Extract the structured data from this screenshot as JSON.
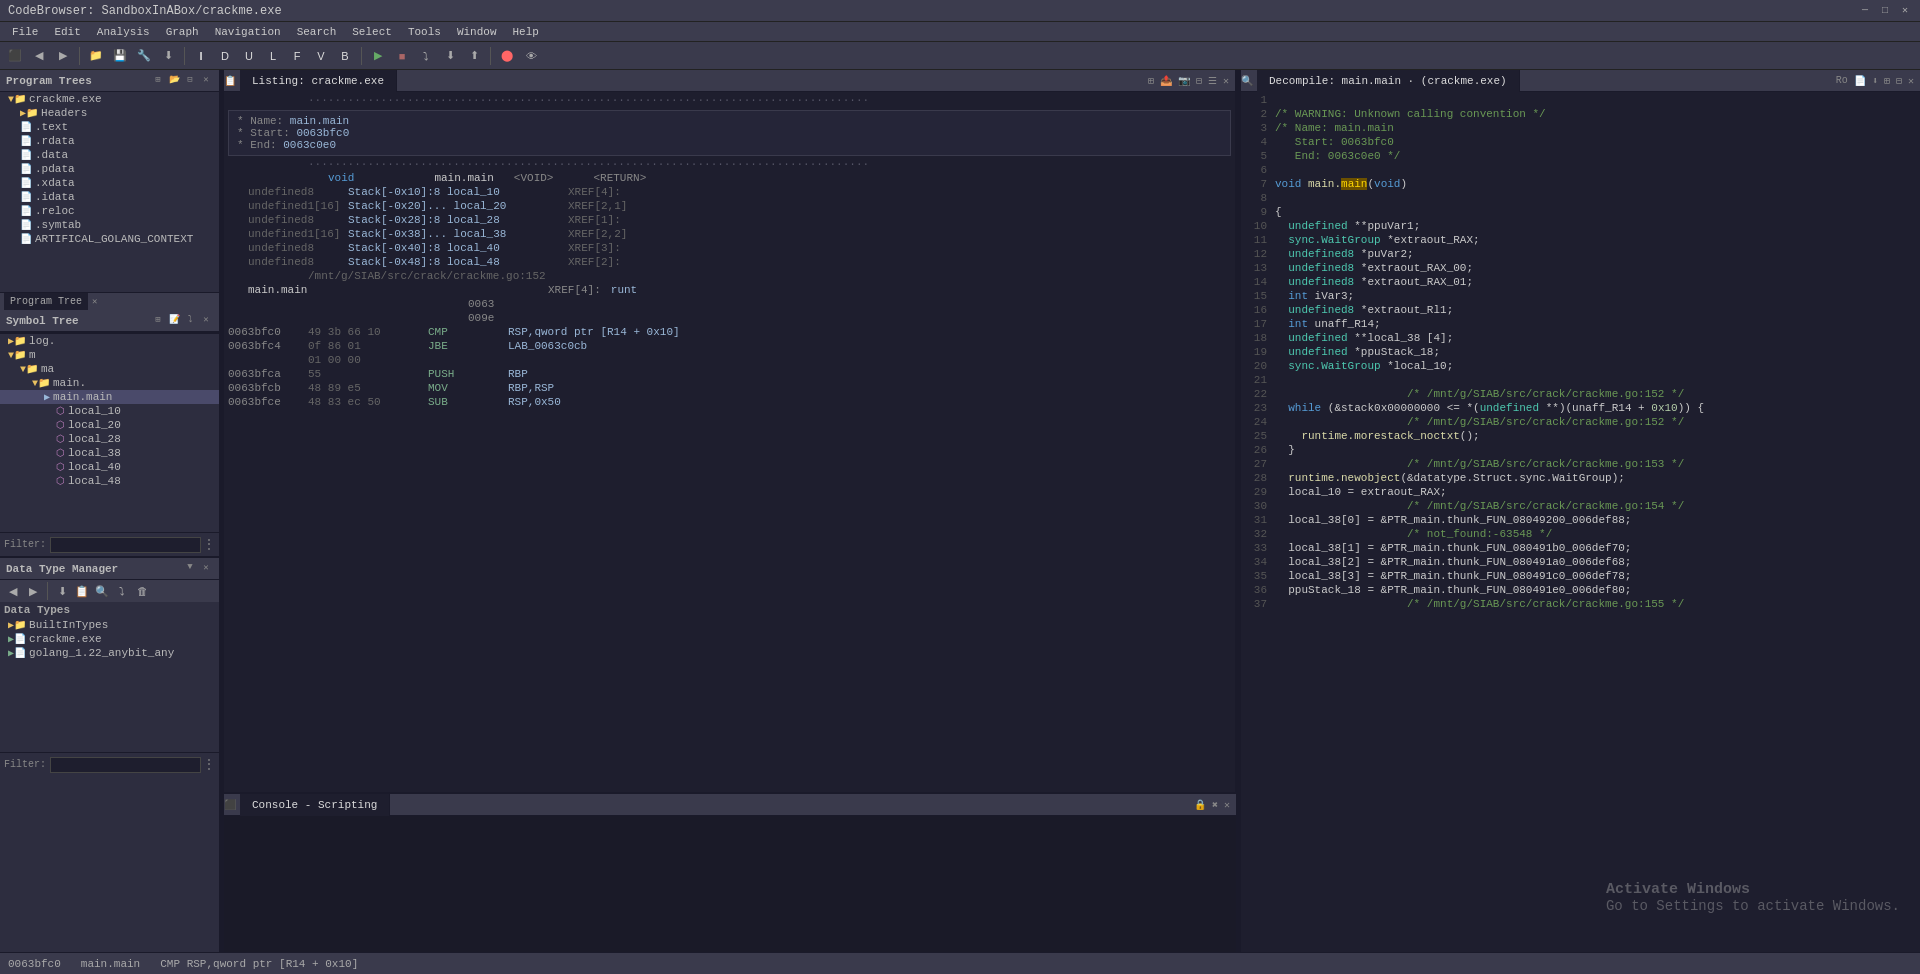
{
  "titlebar": {
    "title": "CodeBrowser: SandboxInABox/crackme.exe",
    "controls": [
      "_",
      "□",
      "×"
    ]
  },
  "menubar": {
    "items": [
      "File",
      "Edit",
      "Analysis",
      "Graph",
      "Navigation",
      "Search",
      "Select",
      "Tools",
      "Window",
      "Help"
    ]
  },
  "left_panel": {
    "program_trees": {
      "title": "Program Trees",
      "items": [
        {
          "label": "crackme.exe",
          "type": "folder",
          "indent": 0
        },
        {
          "label": "Headers",
          "type": "folder",
          "indent": 1
        },
        {
          "label": ".text",
          "type": "section",
          "indent": 1
        },
        {
          "label": ".rdata",
          "type": "section",
          "indent": 1
        },
        {
          "label": ".data",
          "type": "section",
          "indent": 1
        },
        {
          "label": ".pdata",
          "type": "section",
          "indent": 1
        },
        {
          "label": ".xdata",
          "type": "section",
          "indent": 1
        },
        {
          "label": ".idata",
          "type": "section",
          "indent": 1
        },
        {
          "label": ".reloc",
          "type": "section",
          "indent": 1
        },
        {
          "label": ".symtab",
          "type": "section",
          "indent": 1
        },
        {
          "label": "ARTIFICAL_GOLANG_CONTEXT",
          "type": "section",
          "indent": 1
        }
      ]
    },
    "symbol_tree": {
      "title": "Symbol Tree",
      "items": [
        {
          "label": "log.",
          "type": "folder",
          "indent": 0,
          "expanded": false
        },
        {
          "label": "m",
          "type": "folder",
          "indent": 0,
          "expanded": true
        },
        {
          "label": "ma",
          "type": "folder",
          "indent": 1,
          "expanded": true
        },
        {
          "label": "main.",
          "type": "folder",
          "indent": 2,
          "expanded": true
        },
        {
          "label": "main.main",
          "type": "func",
          "indent": 3,
          "selected": true
        },
        {
          "label": "local_10",
          "type": "var",
          "indent": 4
        },
        {
          "label": "local_20",
          "type": "var",
          "indent": 4
        },
        {
          "label": "local_28",
          "type": "var",
          "indent": 4
        },
        {
          "label": "local_38",
          "type": "var",
          "indent": 4
        },
        {
          "label": "local_40",
          "type": "var",
          "indent": 4
        },
        {
          "label": "local_48",
          "type": "var",
          "indent": 4
        }
      ]
    },
    "filter": ""
  },
  "data_type_manager": {
    "title": "Data Type Manager",
    "items": [
      {
        "label": "BuiltInTypes",
        "type": "folder",
        "indent": 0
      },
      {
        "label": "crackme.exe",
        "type": "file",
        "indent": 0
      },
      {
        "label": "golang_1.22_anybit_any",
        "type": "file",
        "indent": 0
      }
    ],
    "filter": ""
  },
  "listing": {
    "title": "Listing: crackme.exe",
    "addr_start": "0063bfc0",
    "info_block": {
      "name": "main.main",
      "start": "0063bfc0",
      "end": "0063c0e0"
    },
    "prototype": "void main.main(void)",
    "params": [
      {
        "type": "<VOID>",
        "name": "<RETURN>"
      }
    ],
    "locals": [
      {
        "type": "undefined8",
        "loc": "Stack[-0x10]:8",
        "name": "local_10",
        "xref": "XREF[4]:"
      },
      {
        "type": "undefined1[16]",
        "loc": "Stack[-0x20]...",
        "name": "local_20",
        "xref": "XREF[2,1]"
      },
      {
        "type": "undefined8",
        "loc": "Stack[-0x28]:8",
        "name": "local_28",
        "xref": "XREF[1]:"
      },
      {
        "type": "undefined1[16]",
        "loc": "Stack[-0x38]...",
        "name": "local_38",
        "xref": "XREF[2,2]"
      },
      {
        "type": "undefined8",
        "loc": "Stack[-0x40]:8",
        "name": "local_40",
        "xref": "XREF[3]:"
      },
      {
        "type": "undefined8",
        "loc": "Stack[-0x48]:8",
        "name": "local_48",
        "xref": "XREF[2]:"
      }
    ],
    "source_comment": "/mnt/g/SIAB/src/crack/crackme.go:152",
    "main_main_label": "main.main",
    "instructions": [
      {
        "addr": "0063bfc0",
        "bytes": "49 3b 66 10",
        "mnem": "CMP",
        "operand": "RSP,qword ptr [R14 + 0x10]"
      },
      {
        "addr": "0063bfc4",
        "bytes": "0f 86 01",
        "mnem": "JBE",
        "operand": "LAB_0063c0cb"
      },
      {
        "addr": "",
        "bytes": "01 00 00",
        "mnem": "",
        "operand": ""
      },
      {
        "addr": "0063bfca",
        "bytes": "55",
        "mnem": "PUSH",
        "operand": "RBP"
      },
      {
        "addr": "0063bfcb",
        "bytes": "48 89 e5",
        "mnem": "MOV",
        "operand": "RBP,RSP"
      },
      {
        "addr": "0063bfce",
        "bytes": "48 83 ec 50",
        "mnem": "SUB",
        "operand": "RSP,0x50"
      }
    ]
  },
  "decompiler": {
    "title": "Decompile: main.main · (crackme.exe)",
    "lines": [
      {
        "num": "1",
        "text": ""
      },
      {
        "num": "2",
        "text": "/* WARNING: Unknown calling convention */",
        "class": "c-comment"
      },
      {
        "num": "3",
        "text": "/* Name: main.main",
        "class": "c-comment"
      },
      {
        "num": "4",
        "text": "   Start: 0063bfc0",
        "class": "c-comment"
      },
      {
        "num": "5",
        "text": "   End: 0063c0e0 */",
        "class": "c-comment"
      },
      {
        "num": "6",
        "text": ""
      },
      {
        "num": "7",
        "text": "void main.main(void)"
      },
      {
        "num": "8",
        "text": ""
      },
      {
        "num": "9",
        "text": "{"
      },
      {
        "num": "10",
        "text": "  undefined **ppuVar1;"
      },
      {
        "num": "11",
        "text": "  sync.WaitGroup *extraout_RAX;"
      },
      {
        "num": "12",
        "text": "  undefined8 *puVar2;"
      },
      {
        "num": "13",
        "text": "  undefined8 *extraout_RAX_00;"
      },
      {
        "num": "14",
        "text": "  undefined8 *extraout_RAX_01;"
      },
      {
        "num": "15",
        "text": "  int iVar3;"
      },
      {
        "num": "16",
        "text": "  undefined8 *extraout_Rl1;"
      },
      {
        "num": "17",
        "text": "  int unaff_R14;"
      },
      {
        "num": "18",
        "text": "  undefined **local_38 [4];"
      },
      {
        "num": "19",
        "text": "  undefined *ppuStack_18;"
      },
      {
        "num": "20",
        "text": "  sync.WaitGroup *local_10;"
      },
      {
        "num": "21",
        "text": ""
      },
      {
        "num": "22",
        "text": "                    /* /mnt/g/SIAB/src/crack/crackme.go:152 */",
        "class": "c-comment"
      },
      {
        "num": "23",
        "text": "  while (&stack0x00000000 <= *(undefined **)(unaff_R14 + 0x10)) {"
      },
      {
        "num": "24",
        "text": "                    /* /mnt/g/SIAB/src/crack/crackme.go:152 */",
        "class": "c-comment"
      },
      {
        "num": "25",
        "text": "    runtime.morestack_noctxt();"
      },
      {
        "num": "26",
        "text": "  }"
      },
      {
        "num": "27",
        "text": "                    /* /mnt/g/SIAB/src/crack/crackme.go:153 */",
        "class": "c-comment"
      },
      {
        "num": "28",
        "text": "  runtime.newobject(&datatype.Struct.sync.WaitGroup);"
      },
      {
        "num": "29",
        "text": "  local_10 = extraout_RAX;"
      },
      {
        "num": "30",
        "text": "                    /* /mnt/g/SIAB/src/crack/crackme.go:154 */",
        "class": "c-comment"
      },
      {
        "num": "31",
        "text": "  local_38[0] = &PTR_main.thunk_FUN_08049200_006def88;"
      },
      {
        "num": "32",
        "text": "                    /* not_found:-63548 */",
        "class": "c-comment"
      },
      {
        "num": "33",
        "text": "  local_38[1] = &PTR_main.thunk_FUN_080491b0_006def70;"
      },
      {
        "num": "34",
        "text": "  local_38[2] = &PTR_main.thunk_FUN_080491a0_006def68;"
      },
      {
        "num": "35",
        "text": "  local_38[3] = &PTR_main.thunk_FUN_080491c0_006def78;"
      },
      {
        "num": "36",
        "text": "  ppuStack_18 = &PTR_main.thunk_FUN_080491e0_006def80;"
      },
      {
        "num": "37",
        "text": "                    /* /mnt/g/SIAB/src/crack/crackme.go:155 */",
        "class": "c-comment"
      }
    ]
  },
  "console": {
    "title": "Console - Scripting"
  },
  "statusbar": {
    "addr": "0063bfc0",
    "func": "main.main",
    "instruction": "CMP RSP,qword ptr [R14 + 0x10]"
  },
  "activate_windows": {
    "line1": "Activate Windows",
    "line2": "Go to Settings to activate Windows."
  }
}
